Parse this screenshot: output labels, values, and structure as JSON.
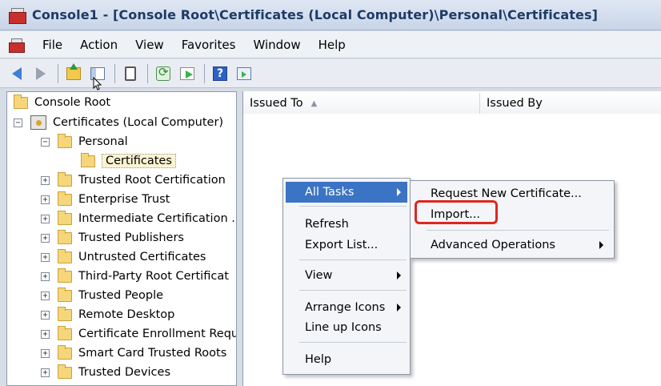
{
  "window": {
    "title": "Console1 - [Console Root\\Certificates (Local Computer)\\Personal\\Certificates]"
  },
  "menubar": {
    "items": [
      "File",
      "Action",
      "View",
      "Favorites",
      "Window",
      "Help"
    ]
  },
  "toolbar": {
    "buttons": [
      "back-icon",
      "forward-icon",
      "up-one-level-icon",
      "show-hide-tree-icon",
      "properties-icon",
      "refresh-icon",
      "export-list-icon",
      "help-icon",
      "show-hide-action-pane-icon"
    ]
  },
  "tree": {
    "items": [
      {
        "label": "Console Root",
        "level": 0
      },
      {
        "label": "Certificates (Local Computer)",
        "level": 1,
        "expander": "⊟"
      },
      {
        "label": "Personal",
        "level": 2,
        "expander": "⊟"
      },
      {
        "label": "Certificates",
        "level": 3,
        "selected": true
      },
      {
        "label": "Trusted Root Certification",
        "level": 2,
        "expander": "⊞"
      },
      {
        "label": "Enterprise Trust",
        "level": 2,
        "expander": "⊞"
      },
      {
        "label": "Intermediate Certification .",
        "level": 2,
        "expander": "⊞"
      },
      {
        "label": "Trusted Publishers",
        "level": 2,
        "expander": "⊞"
      },
      {
        "label": "Untrusted Certificates",
        "level": 2,
        "expander": "⊞"
      },
      {
        "label": "Third-Party Root Certificat",
        "level": 2,
        "expander": "⊞"
      },
      {
        "label": "Trusted People",
        "level": 2,
        "expander": "⊞"
      },
      {
        "label": "Remote Desktop",
        "level": 2,
        "expander": "⊞"
      },
      {
        "label": "Certificate Enrollment Requ",
        "level": 2,
        "expander": "⊞"
      },
      {
        "label": "Smart Card Trusted Roots",
        "level": 2,
        "expander": "⊞"
      },
      {
        "label": "Trusted Devices",
        "level": 2,
        "expander": "⊞"
      }
    ]
  },
  "list": {
    "columns": [
      "Issued To",
      "Issued By"
    ],
    "sort_indicator": "▲"
  },
  "context_menu": {
    "items": [
      "All Tasks",
      "Refresh",
      "Export List...",
      "View",
      "Arrange Icons",
      "Line up Icons",
      "Help"
    ]
  },
  "submenu": {
    "items": [
      "Request New Certificate...",
      "Import...",
      "Advanced Operations"
    ]
  },
  "colors": {
    "highlight": "#3b73c5",
    "annotation": "#e0261f"
  }
}
